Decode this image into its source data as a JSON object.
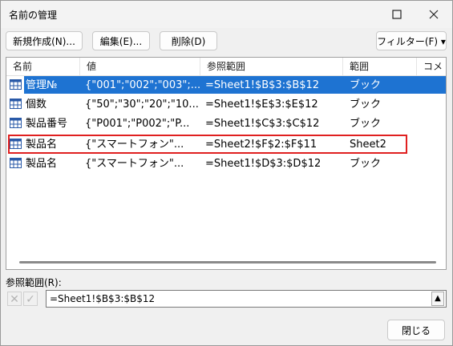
{
  "window": {
    "title": "名前の管理"
  },
  "toolbar": {
    "new_label": "新規作成(N)...",
    "edit_label": "編集(E)...",
    "delete_label": "削除(D)",
    "filter_label": "フィルター(F) ▾"
  },
  "columns": {
    "name": "名前",
    "value": "値",
    "refers_to": "参照範囲",
    "scope": "範囲",
    "comment": "コメ"
  },
  "rows": [
    {
      "name": "管理№",
      "value": "{\"001\";\"002\";\"003\";...",
      "refers_to": "=Sheet1!$B$3:$B$12",
      "scope": "ブック"
    },
    {
      "name": "個数",
      "value": "{\"50\";\"30\";\"20\";\"10...",
      "refers_to": "=Sheet1!$E$3:$E$12",
      "scope": "ブック"
    },
    {
      "name": "製品番号",
      "value": "{\"P001\";\"P002\";\"P...",
      "refers_to": "=Sheet1!$C$3:$C$12",
      "scope": "ブック"
    },
    {
      "name": "製品名",
      "value": "{\"スマートフォン\"...",
      "refers_to": "=Sheet2!$F$2:$F$11",
      "scope": "Sheet2"
    },
    {
      "name": "製品名",
      "value": "{\"スマートフォン\"...",
      "refers_to": "=Sheet1!$D$3:$D$12",
      "scope": "ブック"
    }
  ],
  "reference": {
    "label": "参照範囲(R):",
    "value": "=Sheet1!$B$3:$B$12"
  },
  "close_label": "閉じる",
  "colors": {
    "selection": "#1e73d2",
    "highlight_border": "#e02020"
  }
}
